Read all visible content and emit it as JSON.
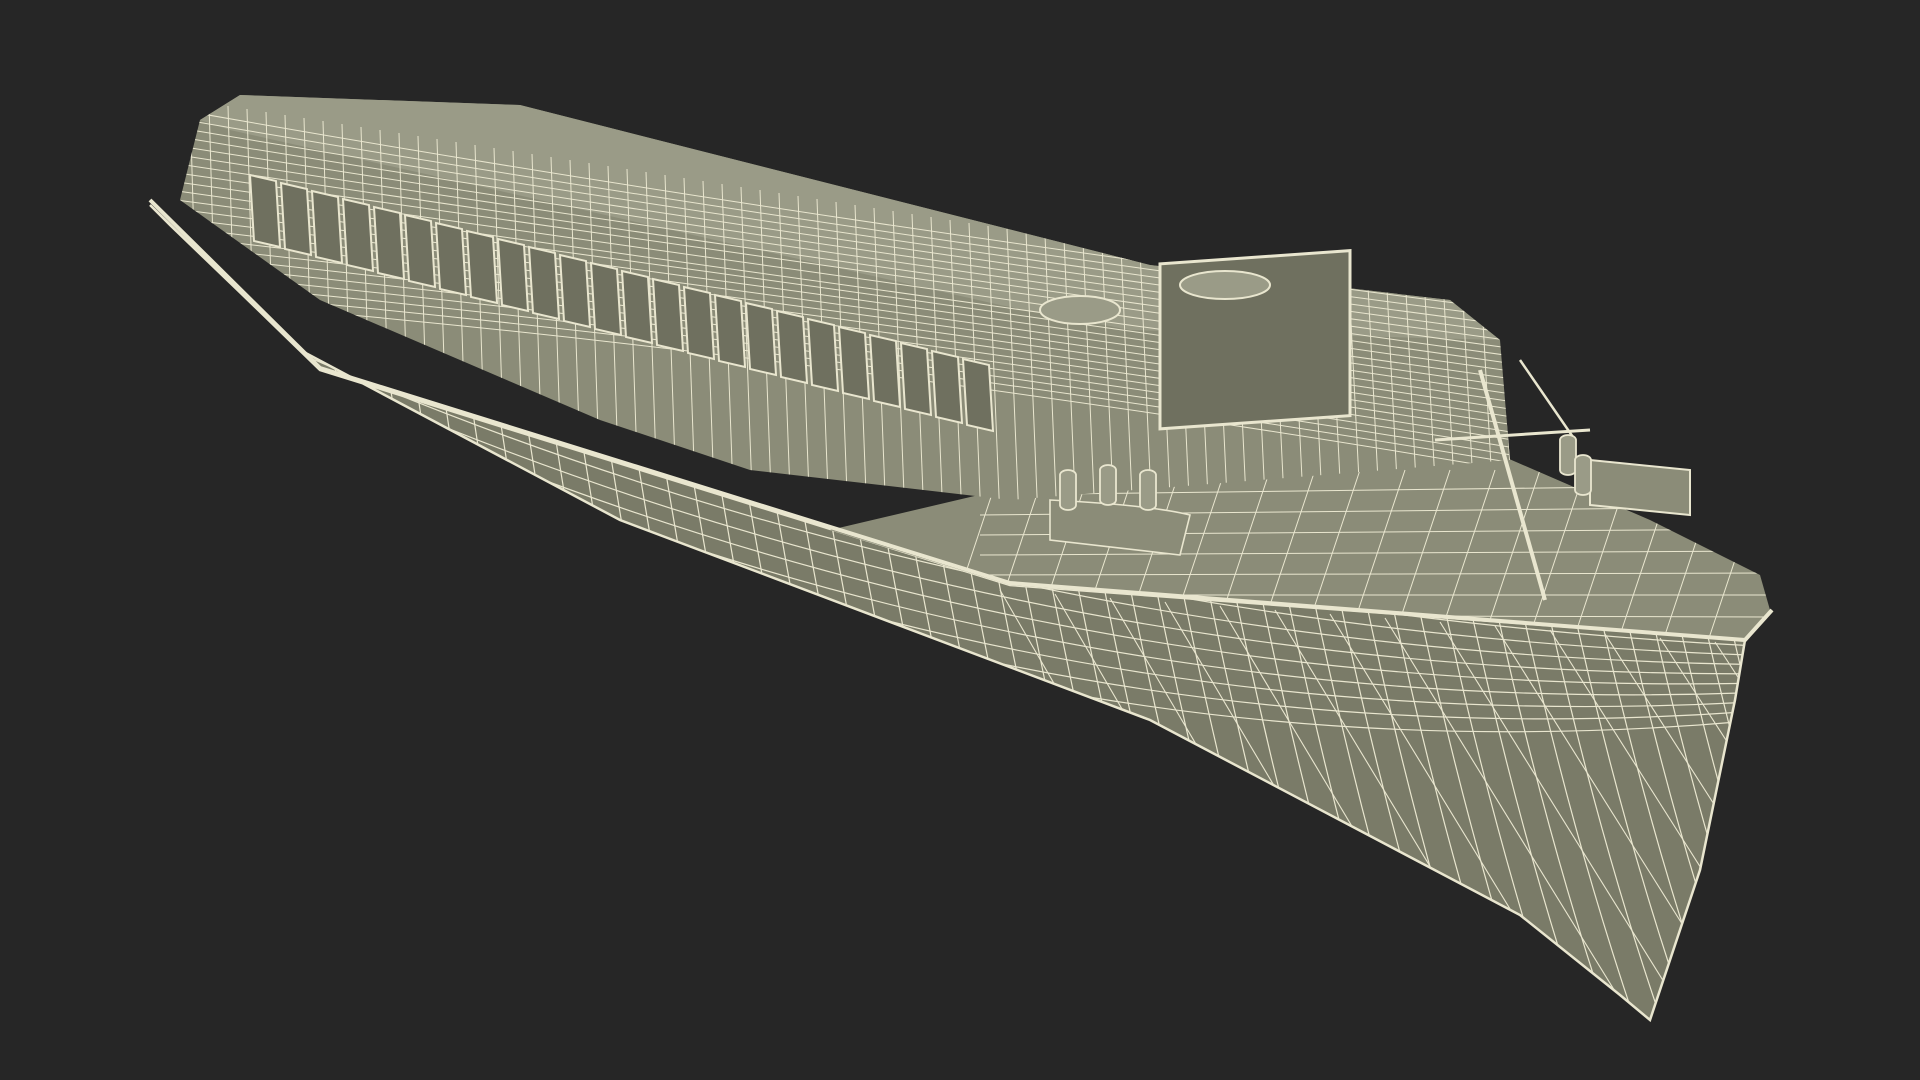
{
  "scene": {
    "subject": "boat-wireframe-render",
    "colors": {
      "background": "#262626",
      "hull_fill": "#7a7b68",
      "hull_shade": "#6c6d5b",
      "cabin_fill": "#8b8c78",
      "roof_fill": "#9a9b87",
      "window_fill": "#6f705f",
      "wire": "#e9e6cf"
    }
  }
}
